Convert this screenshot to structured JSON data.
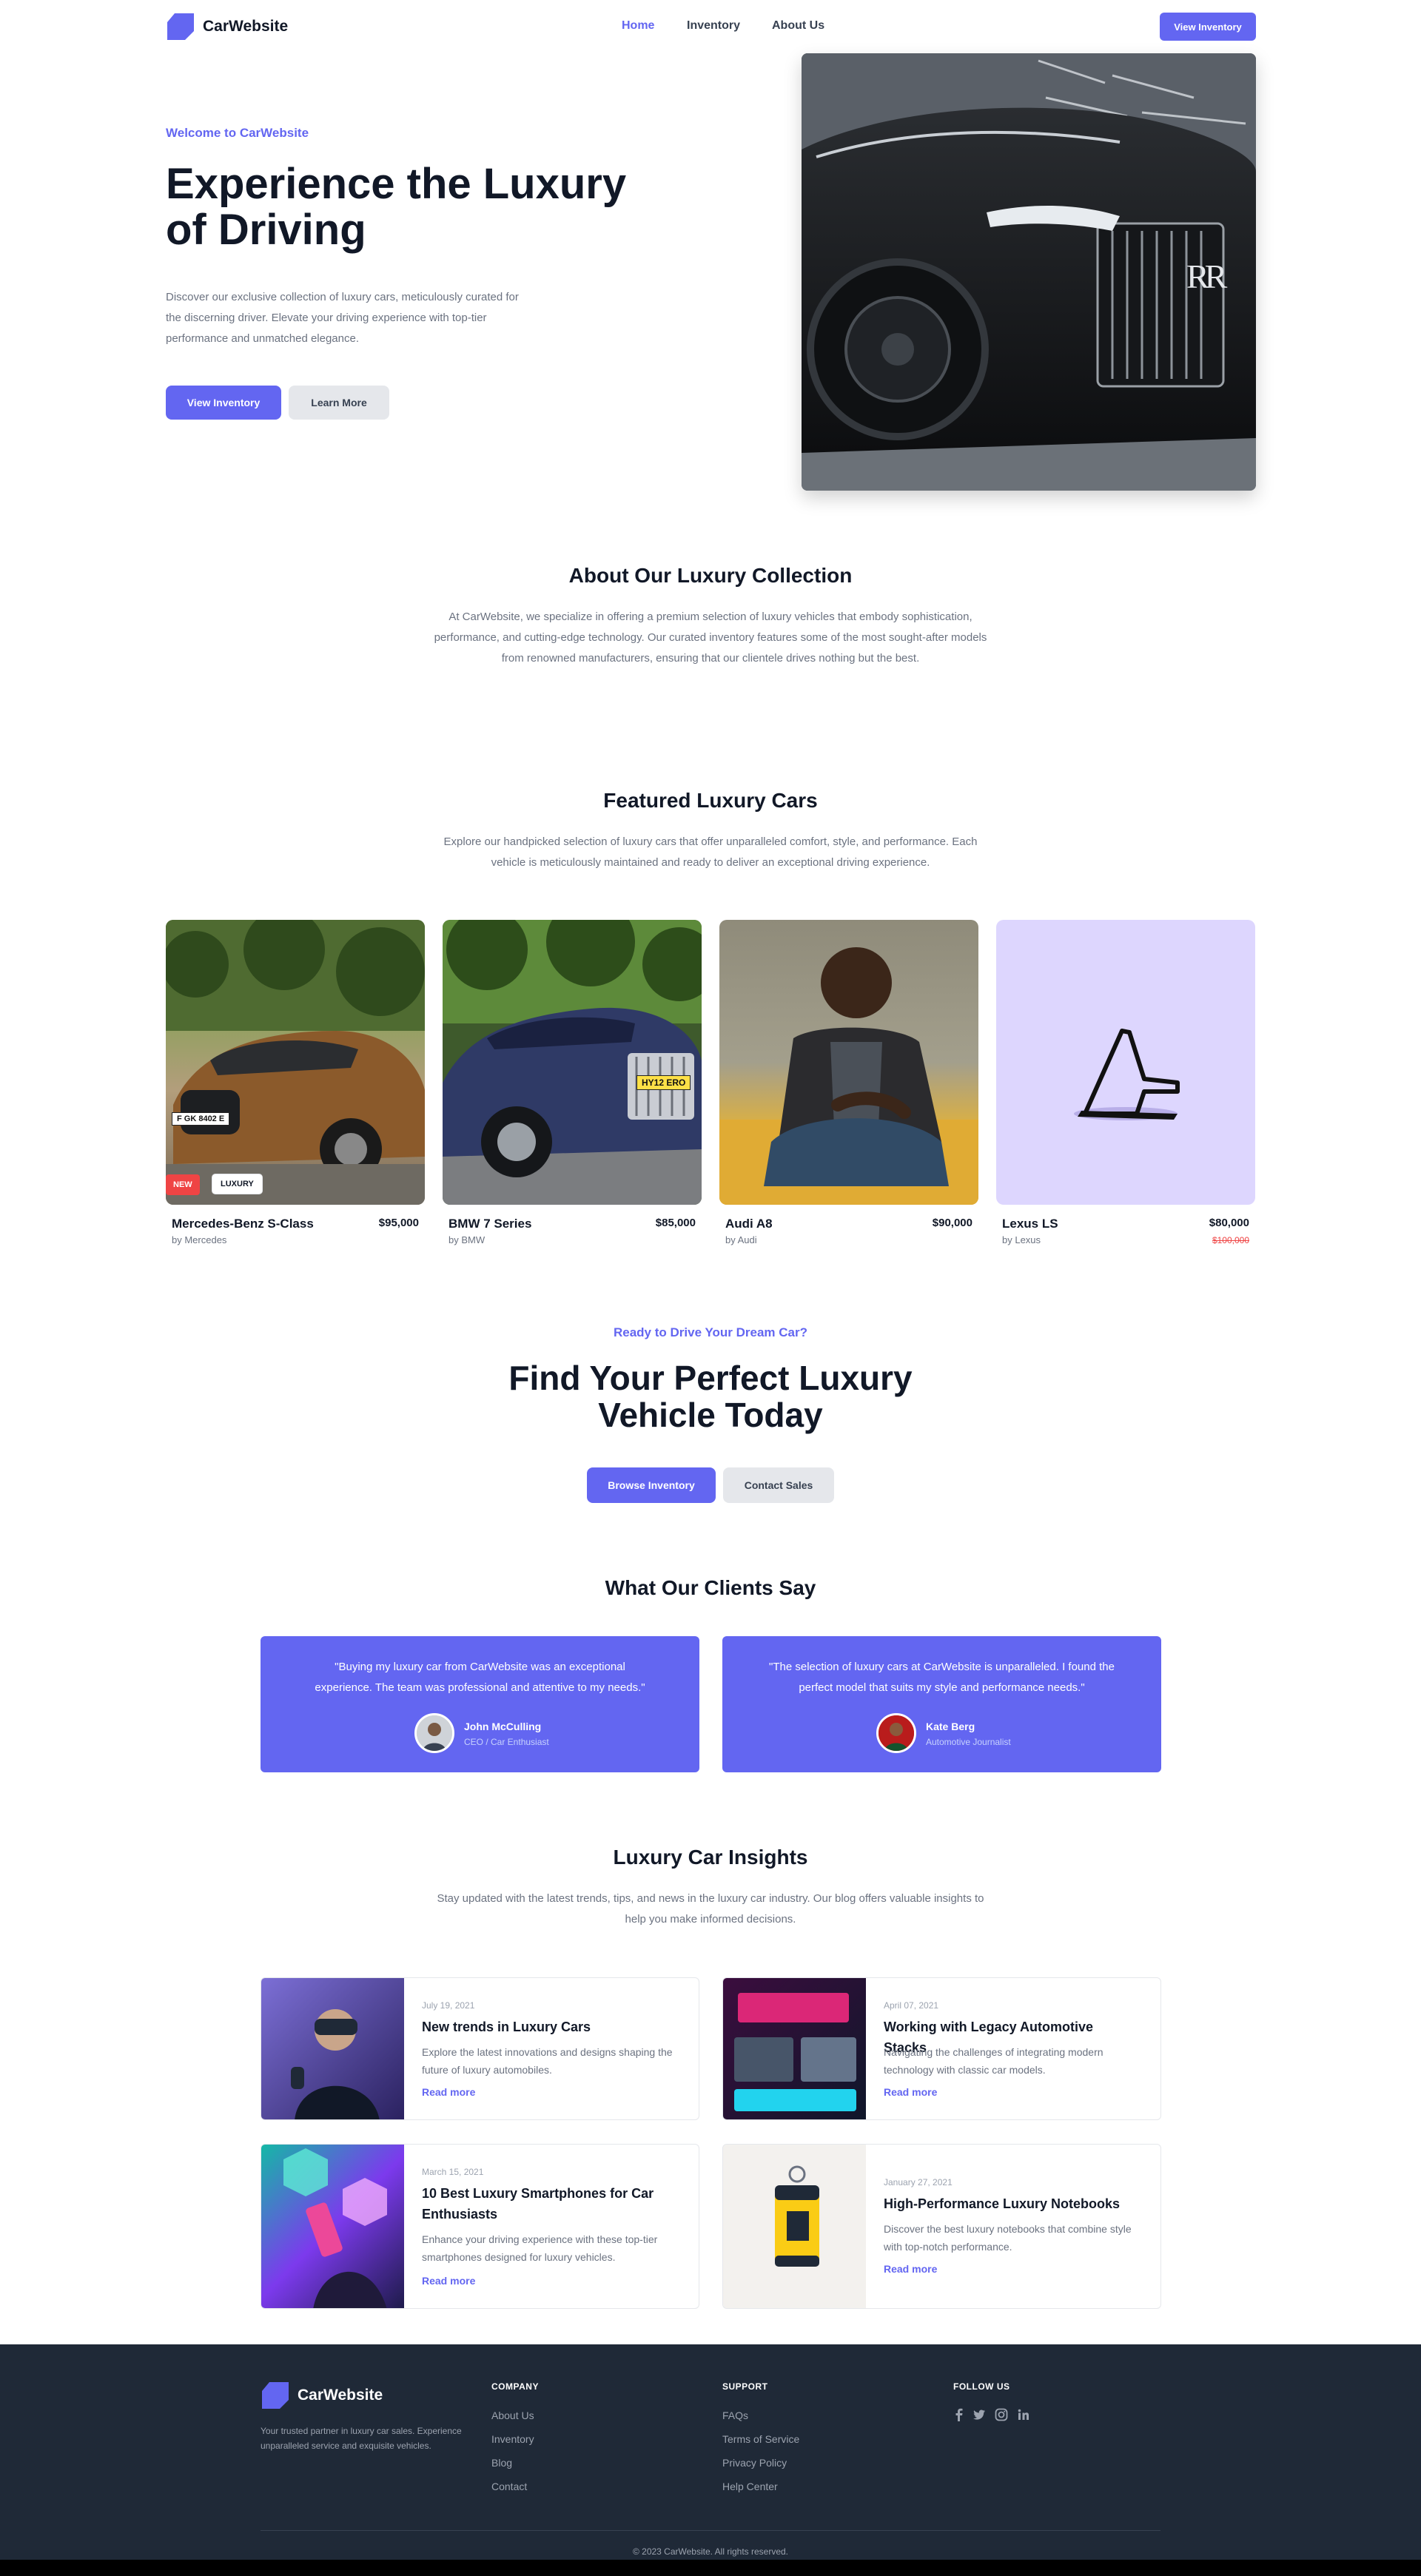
{
  "brand": {
    "name": "CarWebsite",
    "accent": "#6366f1"
  },
  "nav": {
    "home": "Home",
    "inventory": "Inventory",
    "about": "About Us",
    "cta": "View Inventory"
  },
  "hero": {
    "eyebrow": "Welcome to CarWebsite",
    "title": "Experience the Luxury of Driving",
    "description": "Discover our exclusive collection of luxury cars, meticulously curated for the discerning driver. Elevate your driving experience with top-tier performance and unmatched elegance.",
    "primary_button": "View Inventory",
    "secondary_button": "Learn More",
    "image_badge": "RR"
  },
  "about": {
    "title": "About Our Luxury Collection",
    "text": "At CarWebsite, we specialize in offering a premium selection of luxury vehicles that embody sophistication, performance, and cutting-edge technology. Our curated inventory features some of the most sought-after models from renowned manufacturers, ensuring that our clientele drives nothing but the best."
  },
  "featured": {
    "title": "Featured Luxury Cars",
    "text": "Explore our handpicked selection of luxury cars that offer unparalleled comfort, style, and performance. Each vehicle is meticulously maintained and ready to deliver an exceptional driving experience.",
    "cars": [
      {
        "name": "Mercedes-Benz S-Class",
        "price": "$95,000",
        "brand": "by Mercedes",
        "badge_new": "NEW",
        "badge_luxury": "LUXURY",
        "plate": "F GK 8402 E"
      },
      {
        "name": "BMW 7 Series",
        "price": "$85,000",
        "brand": "by BMW",
        "plate": "HY12 ERO"
      },
      {
        "name": "Audi A8",
        "price": "$90,000",
        "brand": "by Audi"
      },
      {
        "name": "Lexus LS",
        "price": "$80,000",
        "old_price": "$100,000",
        "brand": "by Lexus"
      }
    ]
  },
  "cta": {
    "eyebrow": "Ready to Drive Your Dream Car?",
    "title_line1": "Find Your Perfect Luxury",
    "title_line2": "Vehicle Today",
    "primary_button": "Browse Inventory",
    "secondary_button": "Contact Sales"
  },
  "testimonials": {
    "title": "What Our Clients Say",
    "items": [
      {
        "quote": "\"Buying my luxury car from CarWebsite was an exceptional experience. The team was professional and attentive to my needs.\"",
        "name": "John McCulling",
        "role": "CEO / Car Enthusiast"
      },
      {
        "quote": "\"The selection of luxury cars at CarWebsite is unparalleled. I found the perfect model that suits my style and performance needs.\"",
        "name": "Kate Berg",
        "role": "Automotive Journalist"
      }
    ]
  },
  "insights": {
    "title": "Luxury Car Insights",
    "text": "Stay updated with the latest trends, tips, and news in the luxury car industry. Our blog offers valuable insights to help you make informed decisions.",
    "posts": [
      {
        "date": "July 19, 2021",
        "title": "New trends in Luxury Cars",
        "desc": "Explore the latest innovations and designs shaping the future of luxury automobiles.",
        "more": "Read more"
      },
      {
        "date": "April 07, 2021",
        "title": "Working with Legacy Automotive Stacks",
        "desc": "Navigating the challenges of integrating modern technology with classic car models.",
        "more": "Read more"
      },
      {
        "date": "March 15, 2021",
        "title": "10 Best Luxury Smartphones for Car Enthusiasts",
        "desc": "Enhance your driving experience with these top-tier smartphones designed for luxury vehicles.",
        "more": "Read more"
      },
      {
        "date": "January 27, 2021",
        "title": "High-Performance Luxury Notebooks",
        "desc": "Discover the best luxury notebooks that combine style with top-notch performance.",
        "more": "Read more"
      }
    ]
  },
  "footer": {
    "brand": "CarWebsite",
    "tagline": "Your trusted partner in luxury car sales. Experience unparalleled service and exquisite vehicles.",
    "company_head": "COMPANY",
    "company": [
      "About Us",
      "Inventory",
      "Blog",
      "Contact"
    ],
    "support_head": "SUPPORT",
    "support": [
      "FAQs",
      "Terms of Service",
      "Privacy Policy",
      "Help Center"
    ],
    "follow_head": "FOLLOW US",
    "social": [
      "facebook-icon",
      "twitter-icon",
      "instagram-icon",
      "linkedin-icon"
    ],
    "copyright": "© 2023 CarWebsite. All rights reserved."
  }
}
